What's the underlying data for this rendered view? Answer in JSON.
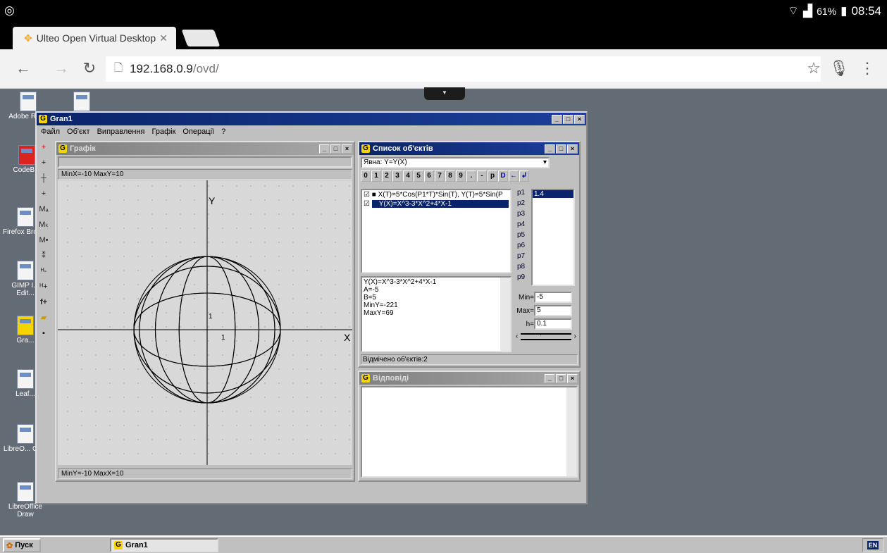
{
  "statusbar": {
    "battery": "61%",
    "time": "08:54"
  },
  "browser": {
    "tab_title": "Ulteo Open Virtual Desktop",
    "url_host": "192.168.0.9",
    "url_path": "/ovd/"
  },
  "desktop_icons": [
    {
      "label": "Adobe R... 9"
    },
    {
      "label": ""
    },
    {
      "label": "CodeB..."
    },
    {
      "label": "Firefox Brow..."
    },
    {
      "label": "GIMP I... Edit..."
    },
    {
      "label": "Gra..."
    },
    {
      "label": "Leaf..."
    },
    {
      "label": "LibreO... Ca..."
    },
    {
      "label": "LibreOffice Draw"
    }
  ],
  "app": {
    "title": "Gran1",
    "menu": [
      "Файл",
      "Об'єкт",
      "Виправлення",
      "Графік",
      "Операції",
      "?"
    ],
    "graph_window": {
      "title": "Графік",
      "top_status": "MinX=-10  MaxY=10",
      "bottom_status": "MinY=-10  MaxX=10",
      "axis_x": "X",
      "axis_y": "Y",
      "tick_x": "1",
      "tick_y": "1"
    },
    "objects_window": {
      "title": "Список об'єктів",
      "type_select": "Явна: Y=Y(X)",
      "keys": [
        "0",
        "1",
        "2",
        "3",
        "4",
        "5",
        "6",
        "7",
        "8",
        "9",
        ".",
        "-",
        "p",
        "D",
        "←",
        "↲"
      ],
      "objects": [
        {
          "text": "X(T)=5*Cos(P1*T)*Sin(T), Y(T)=5*Sin(P",
          "checked": true
        },
        {
          "text": "Y(X)=X^3-3*X^2+4*X-1",
          "checked": true
        }
      ],
      "params": [
        "p1",
        "p2",
        "p3",
        "p4",
        "p5",
        "p6",
        "p7",
        "p8",
        "p9"
      ],
      "p1_value": "1.4",
      "info_lines": [
        "Y(X)=X^3-3*X^2+4*X-1",
        "A=-5",
        "B=5",
        "MinY=-221",
        "MaxY=69"
      ],
      "min_label": "Min=",
      "min_value": "-5",
      "max_label": "Max=",
      "max_value": "5",
      "h_label": "h=",
      "h_value": "0.1",
      "status": "Відмічено об'єктів:2"
    },
    "answers_window": {
      "title": "Відповіді"
    }
  },
  "taskbar": {
    "start_label": "Пуск",
    "task_label": "Gran1",
    "lang": "EN"
  }
}
